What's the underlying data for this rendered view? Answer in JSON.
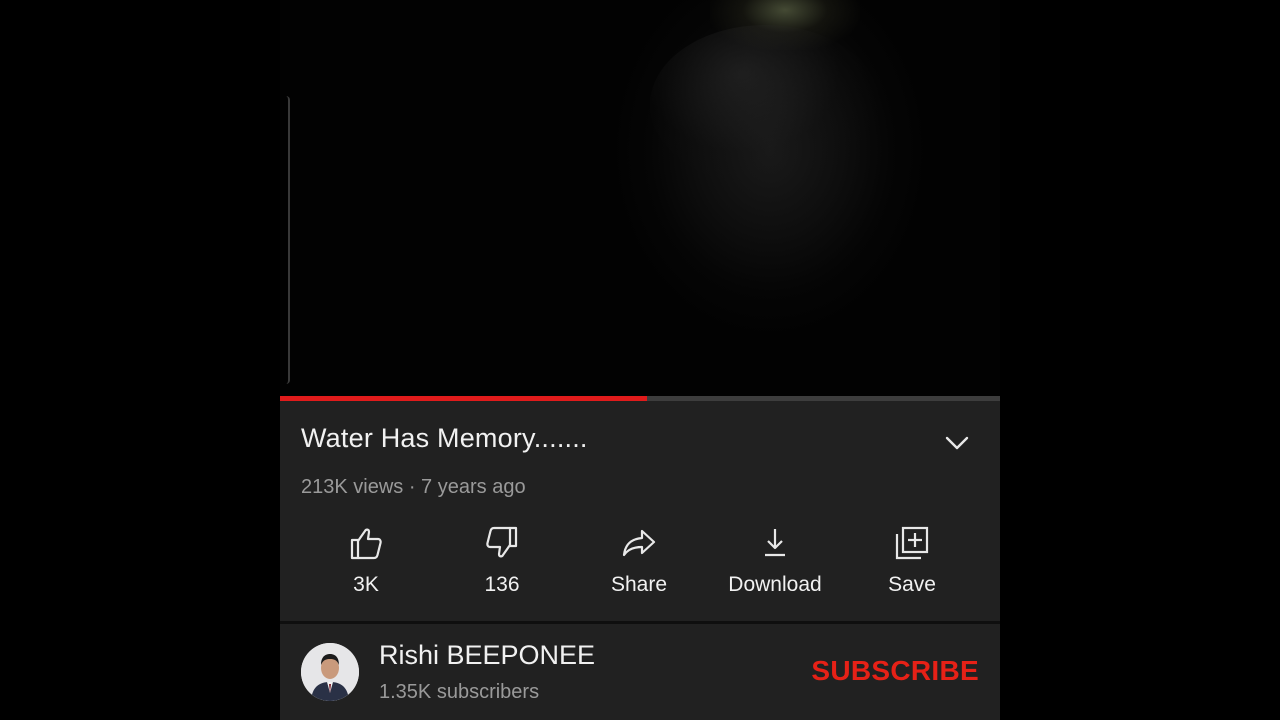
{
  "video": {
    "title": "Water Has Memory.......",
    "meta": "213K views · 7 years ago",
    "progress_fraction": 0.51
  },
  "actions": [
    {
      "label": "3K",
      "icon": "thumbs-up-icon"
    },
    {
      "label": "136",
      "icon": "thumbs-down-icon"
    },
    {
      "label": "Share",
      "icon": "share-arrow-icon"
    },
    {
      "label": "Download",
      "icon": "download-icon"
    },
    {
      "label": "Save",
      "icon": "add-to-playlist-icon"
    }
  ],
  "channel": {
    "name": "Rishi BEEPONEE",
    "subscribers": "1.35K subscribers",
    "subscribe_label": "SUBSCRIBE"
  },
  "colors": {
    "accent_red": "#e62117",
    "progress_red": "#e01b1b",
    "panel_bg": "#212121",
    "text_primary": "#f1f1f1",
    "text_secondary": "#9a9a9a"
  }
}
